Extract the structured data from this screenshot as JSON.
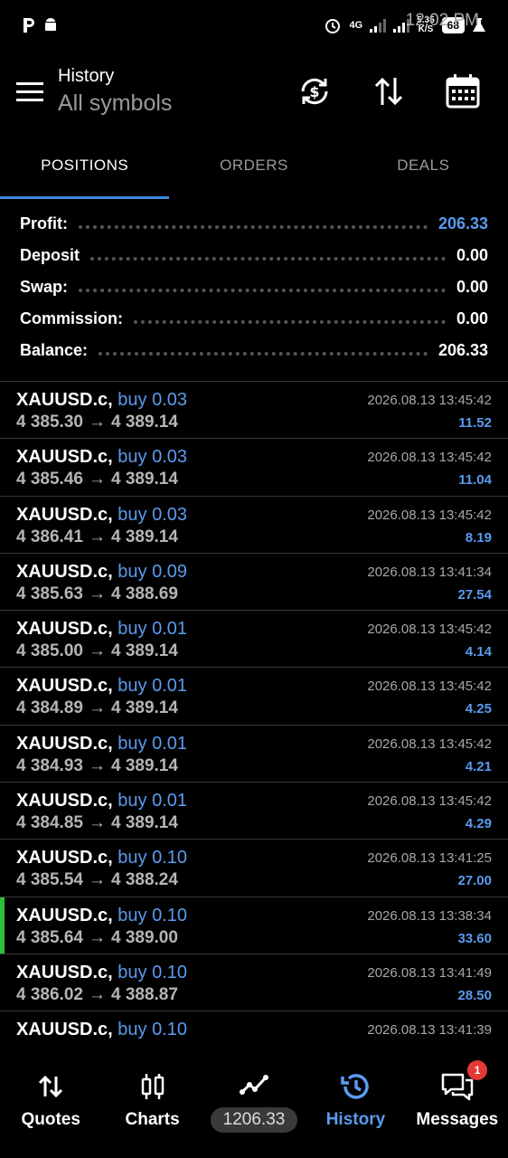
{
  "status": {
    "time": "12:02 PM",
    "network": "4G",
    "speed_top": "5.35",
    "speed_unit": "K/S",
    "battery": "68"
  },
  "appbar": {
    "title": "History",
    "subtitle": "All symbols"
  },
  "tabs": [
    {
      "label": "POSITIONS",
      "active": true
    },
    {
      "label": "ORDERS",
      "active": false
    },
    {
      "label": "DEALS",
      "active": false
    }
  ],
  "summary": {
    "profit_label": "Profit:",
    "profit_value": "206.33",
    "deposit_label": "Deposit",
    "deposit_value": "0.00",
    "swap_label": "Swap:",
    "swap_value": "0.00",
    "commission_label": "Commission:",
    "commission_value": "0.00",
    "balance_label": "Balance:",
    "balance_value": "206.33"
  },
  "deals": [
    {
      "symbol": "XAUUSD.c,",
      "side": "buy 0.03",
      "open": "4 385.30",
      "close": "4 389.14",
      "time": "2026.08.13 13:45:42",
      "profit": "11.52"
    },
    {
      "symbol": "XAUUSD.c,",
      "side": "buy 0.03",
      "open": "4 385.46",
      "close": "4 389.14",
      "time": "2026.08.13 13:45:42",
      "profit": "11.04"
    },
    {
      "symbol": "XAUUSD.c,",
      "side": "buy 0.03",
      "open": "4 386.41",
      "close": "4 389.14",
      "time": "2026.08.13 13:45:42",
      "profit": "8.19"
    },
    {
      "symbol": "XAUUSD.c,",
      "side": "buy 0.09",
      "open": "4 385.63",
      "close": "4 388.69",
      "time": "2026.08.13 13:41:34",
      "profit": "27.54"
    },
    {
      "symbol": "XAUUSD.c,",
      "side": "buy 0.01",
      "open": "4 385.00",
      "close": "4 389.14",
      "time": "2026.08.13 13:45:42",
      "profit": "4.14"
    },
    {
      "symbol": "XAUUSD.c,",
      "side": "buy 0.01",
      "open": "4 384.89",
      "close": "4 389.14",
      "time": "2026.08.13 13:45:42",
      "profit": "4.25"
    },
    {
      "symbol": "XAUUSD.c,",
      "side": "buy 0.01",
      "open": "4 384.93",
      "close": "4 389.14",
      "time": "2026.08.13 13:45:42",
      "profit": "4.21"
    },
    {
      "symbol": "XAUUSD.c,",
      "side": "buy 0.01",
      "open": "4 384.85",
      "close": "4 389.14",
      "time": "2026.08.13 13:45:42",
      "profit": "4.29"
    },
    {
      "symbol": "XAUUSD.c,",
      "side": "buy 0.10",
      "open": "4 385.54",
      "close": "4 388.24",
      "time": "2026.08.13 13:41:25",
      "profit": "27.00"
    },
    {
      "symbol": "XAUUSD.c,",
      "side": "buy 0.10",
      "open": "4 385.64",
      "close": "4 389.00",
      "time": "2026.08.13 13:38:34",
      "profit": "33.60"
    },
    {
      "symbol": "XAUUSD.c,",
      "side": "buy 0.10",
      "open": "4 386.02",
      "close": "4 388.87",
      "time": "2026.08.13 13:41:49",
      "profit": "28.50"
    },
    {
      "symbol": "XAUUSD.c,",
      "side": "buy 0.10",
      "open": "",
      "close": "",
      "time": "2026.08.13 13:41:39",
      "profit": ""
    }
  ],
  "arrow_glyph": "→",
  "bottomnav": {
    "quotes": "Quotes",
    "charts": "Charts",
    "balance": "1206.33",
    "history": "History",
    "messages": "Messages",
    "messages_badge": "1"
  },
  "colors": {
    "accent": "#5a9bef",
    "highlight": "#2fbf3a",
    "badge": "#e53935"
  }
}
